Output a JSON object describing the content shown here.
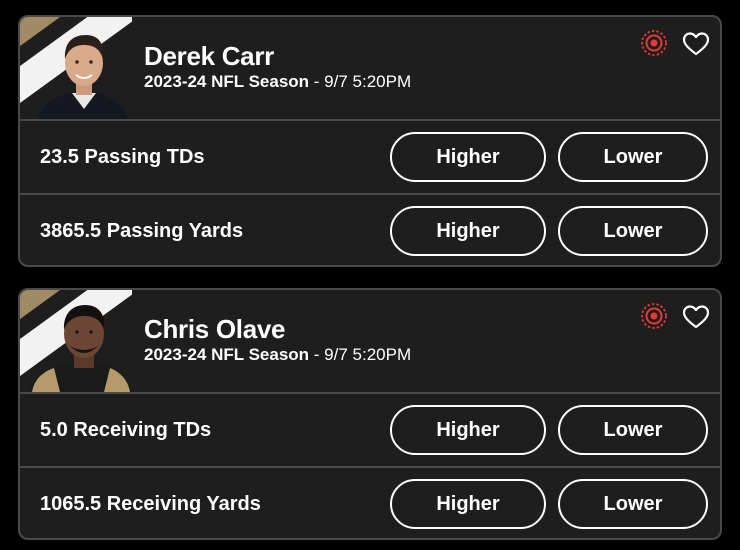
{
  "colors": {
    "background": "#000000",
    "card": "#1e1e1e",
    "border": "#4a4a4a",
    "team_gold": "#a08b64",
    "accent_red": "#e53935",
    "text": "#ffffff"
  },
  "cards": [
    {
      "player_name": "Derek Carr",
      "season": "2023-24 NFL Season",
      "separator": " - ",
      "game_time": "9/7 5:20PM",
      "icons": {
        "target": "target-icon",
        "favorite": "heart-outline-icon"
      },
      "props": [
        {
          "label": "23.5 Passing TDs",
          "higher": "Higher",
          "lower": "Lower"
        },
        {
          "label": "3865.5 Passing Yards",
          "higher": "Higher",
          "lower": "Lower"
        }
      ]
    },
    {
      "player_name": "Chris Olave",
      "season": "2023-24 NFL Season",
      "separator": " - ",
      "game_time": "9/7 5:20PM",
      "icons": {
        "target": "target-icon",
        "favorite": "heart-outline-icon"
      },
      "props": [
        {
          "label": "5.0 Receiving TDs",
          "higher": "Higher",
          "lower": "Lower"
        },
        {
          "label": "1065.5 Receiving Yards",
          "higher": "Higher",
          "lower": "Lower"
        }
      ]
    }
  ]
}
